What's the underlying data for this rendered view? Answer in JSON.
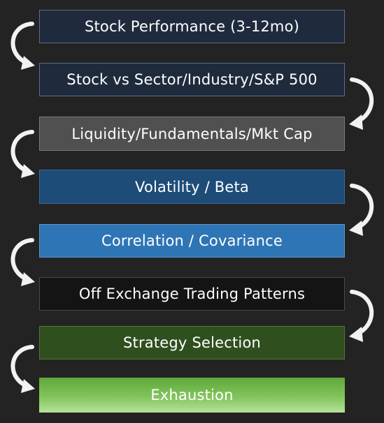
{
  "steps": [
    {
      "label": "Stock Performance (3-12mo)"
    },
    {
      "label": "Stock vs Sector/Industry/S&P 500"
    },
    {
      "label": "Liquidity/Fundamentals/Mkt Cap"
    },
    {
      "label": "Volatility / Beta"
    },
    {
      "label": "Correlation / Covariance"
    },
    {
      "label": "Off Exchange Trading Patterns"
    },
    {
      "label": "Strategy Selection"
    },
    {
      "label": "Exhaustion"
    }
  ],
  "colors": {
    "background": "#232323",
    "box_dark_navy": "#1f2b3d",
    "box_gray": "#505050",
    "box_navy": "#1e4c79",
    "box_blue": "#2e75b6",
    "box_black": "#141414",
    "box_dark_green": "#2f4f1f",
    "box_green": "#82c45c",
    "arrow": "#f2f2f2"
  },
  "icons": {
    "connector": "curved-arrow-icon"
  }
}
